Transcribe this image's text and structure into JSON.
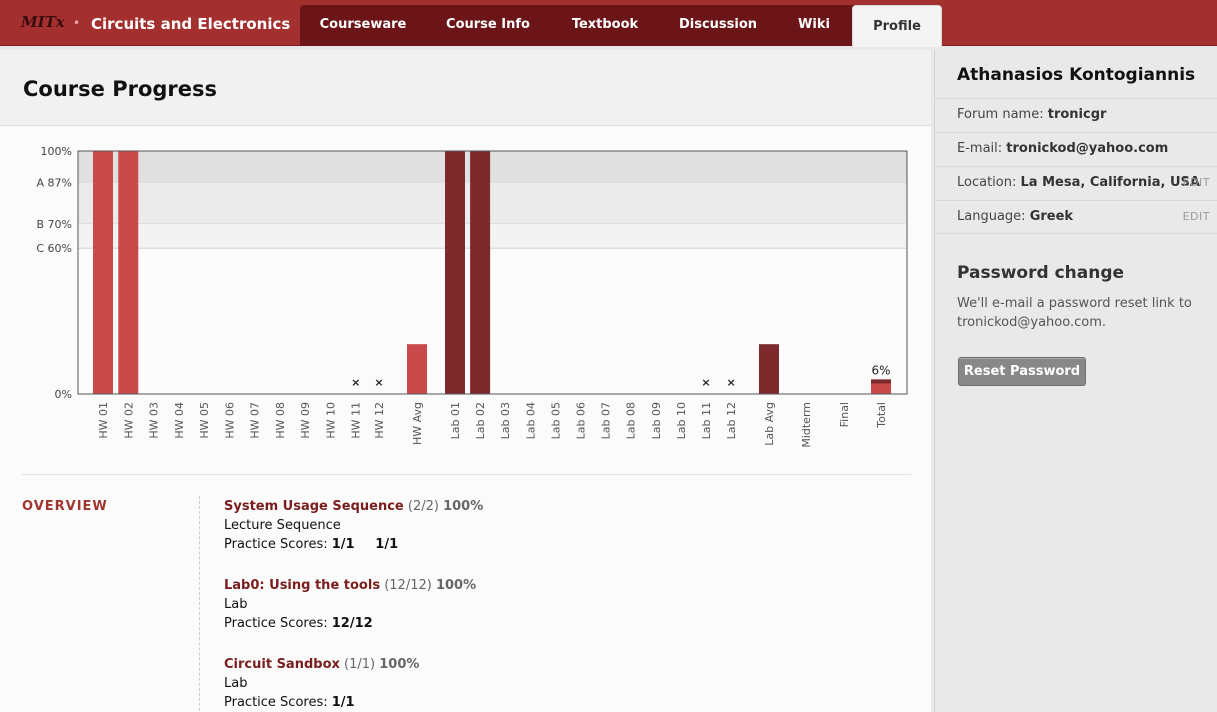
{
  "header": {
    "logo": "MITx",
    "course_title": "Circuits and Electronics",
    "tabs": [
      {
        "label": "Courseware",
        "active": false
      },
      {
        "label": "Course Info",
        "active": false
      },
      {
        "label": "Textbook",
        "active": false
      },
      {
        "label": "Discussion",
        "active": false
      },
      {
        "label": "Wiki",
        "active": false
      },
      {
        "label": "Profile",
        "active": true
      }
    ]
  },
  "main": {
    "page_title": "Course Progress",
    "overview_label": "OVERVIEW",
    "sections": [
      {
        "title": "System Usage Sequence",
        "count": "(2/2)",
        "percent": "100%",
        "format": "Lecture Sequence",
        "scores_label": "Practice Scores:",
        "scores": [
          "1/1",
          "1/1"
        ]
      },
      {
        "title": "Lab0: Using the tools",
        "count": "(12/12)",
        "percent": "100%",
        "format": "Lab",
        "scores_label": "Practice Scores:",
        "scores": [
          "12/12"
        ]
      },
      {
        "title": "Circuit Sandbox",
        "count": "(1/1)",
        "percent": "100%",
        "format": "Lab",
        "scores_label": "Practice Scores:",
        "scores": [
          "1/1"
        ]
      }
    ]
  },
  "sidebar": {
    "user_name": "Athanasios Kontogiannis",
    "forum": {
      "label": "Forum name:",
      "value": "tronicgr"
    },
    "email": {
      "label": "E-mail:",
      "value": "tronickod@yahoo.com"
    },
    "location": {
      "label": "Location:",
      "value": "La Mesa, California, USA",
      "edit": "EDIT"
    },
    "language": {
      "label": "Language:",
      "value": "Greek",
      "edit": "EDIT"
    },
    "password": {
      "title": "Password change",
      "text": "We'll e-mail a password reset link to tronickod@yahoo.com.",
      "button": "Reset Password"
    }
  },
  "chart_data": {
    "type": "bar",
    "ylim": [
      0,
      100
    ],
    "yticks": [
      {
        "value": 100,
        "label": "100%"
      },
      {
        "value": 87,
        "label": "A 87%"
      },
      {
        "value": 70,
        "label": "B 70%"
      },
      {
        "value": 60,
        "label": "C 60%"
      },
      {
        "value": 0,
        "label": "0%"
      }
    ],
    "grade_bands": [
      {
        "from": 87,
        "to": 100,
        "color": "#e0e0e0"
      },
      {
        "from": 70,
        "to": 87,
        "color": "#ebebeb"
      },
      {
        "from": 60,
        "to": 70,
        "color": "#f3f3f3"
      }
    ],
    "colors": {
      "hw": "#c94a4a",
      "lab": "#7d2a2d",
      "total": "#c94a4a",
      "total_top": "#7d2a2d"
    },
    "categories": [
      "HW 01",
      "HW 02",
      "HW 03",
      "HW 04",
      "HW 05",
      "HW 06",
      "HW 07",
      "HW 08",
      "HW 09",
      "HW 10",
      "HW 11",
      "HW 12",
      "HW Avg",
      "Lab 01",
      "Lab 02",
      "Lab 03",
      "Lab 04",
      "Lab 05",
      "Lab 06",
      "Lab 07",
      "Lab 08",
      "Lab 09",
      "Lab 10",
      "Lab 11",
      "Lab 12",
      "Lab Avg",
      "Midterm",
      "Final",
      "Total"
    ],
    "series": [
      {
        "values": [
          100,
          100,
          0,
          0,
          0,
          0,
          0,
          0,
          0,
          0,
          0,
          0,
          20.5,
          100,
          100,
          0,
          0,
          0,
          0,
          0,
          0,
          0,
          0,
          0,
          0,
          20.5,
          0,
          0,
          6
        ]
      }
    ],
    "kind": [
      "hw",
      "hw",
      "hw",
      "hw",
      "hw",
      "hw",
      "hw",
      "hw",
      "hw",
      "hw",
      "hw",
      "hw",
      "hw",
      "lab",
      "lab",
      "lab",
      "lab",
      "lab",
      "lab",
      "lab",
      "lab",
      "lab",
      "lab",
      "lab",
      "lab",
      "lab",
      "exam",
      "exam",
      "total"
    ],
    "dropped": [
      "HW 11",
      "HW 12",
      "Lab 11",
      "Lab 12"
    ],
    "drop_marker": "×",
    "data_labels": [
      {
        "category": "Total",
        "text": "6%"
      }
    ]
  }
}
